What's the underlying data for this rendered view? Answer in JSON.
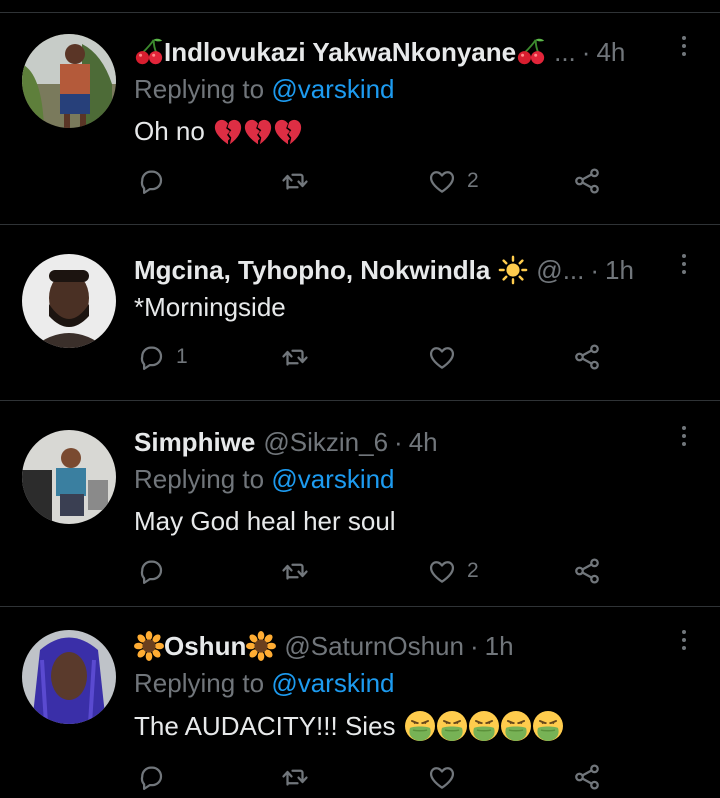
{
  "tweets": [
    {
      "name": "Indlovukazi YakwaNkonyane",
      "name_prefix_emoji": "cherries",
      "name_suffix_emoji": "cherries",
      "handle": "...",
      "time": "4h",
      "replying_label": "Replying to",
      "replying_handle": "@varskind",
      "text": "Oh no",
      "text_emojis": [
        "broken-heart",
        "broken-heart",
        "broken-heart"
      ],
      "reply_count": "",
      "like_count": "2"
    },
    {
      "name": "Mgcina, Tyhopho, Nokwindla",
      "name_suffix_emoji": "sun",
      "handle": "@...",
      "time": "1h",
      "text": "*Morningside",
      "reply_count": "1",
      "like_count": ""
    },
    {
      "name": "Simphiwe",
      "handle": "@Sikzin_6",
      "time": "4h",
      "replying_label": "Replying to",
      "replying_handle": "@varskind",
      "text": "May God heal her soul",
      "reply_count": "",
      "like_count": "2"
    },
    {
      "name": "Oshun",
      "name_prefix_emoji": "sunflower",
      "name_suffix_emoji": "sunflower",
      "handle": "@SaturnOshun",
      "time": "1h",
      "replying_label": "Replying to",
      "replying_handle": "@varskind",
      "text": "The AUDACITY!!! Sies",
      "text_emojis": [
        "vomiting-face",
        "vomiting-face",
        "vomiting-face",
        "vomiting-face",
        "vomiting-face"
      ],
      "reply_count": "",
      "like_count": ""
    }
  ],
  "dot_separator": "·",
  "colors": {
    "background": "#000000",
    "text": "#e7e9ea",
    "muted": "#71767b",
    "link": "#1d9bf0",
    "divider": "#2f3336"
  },
  "icons": [
    "reply-icon",
    "retweet-icon",
    "like-icon",
    "share-icon",
    "more-icon"
  ]
}
